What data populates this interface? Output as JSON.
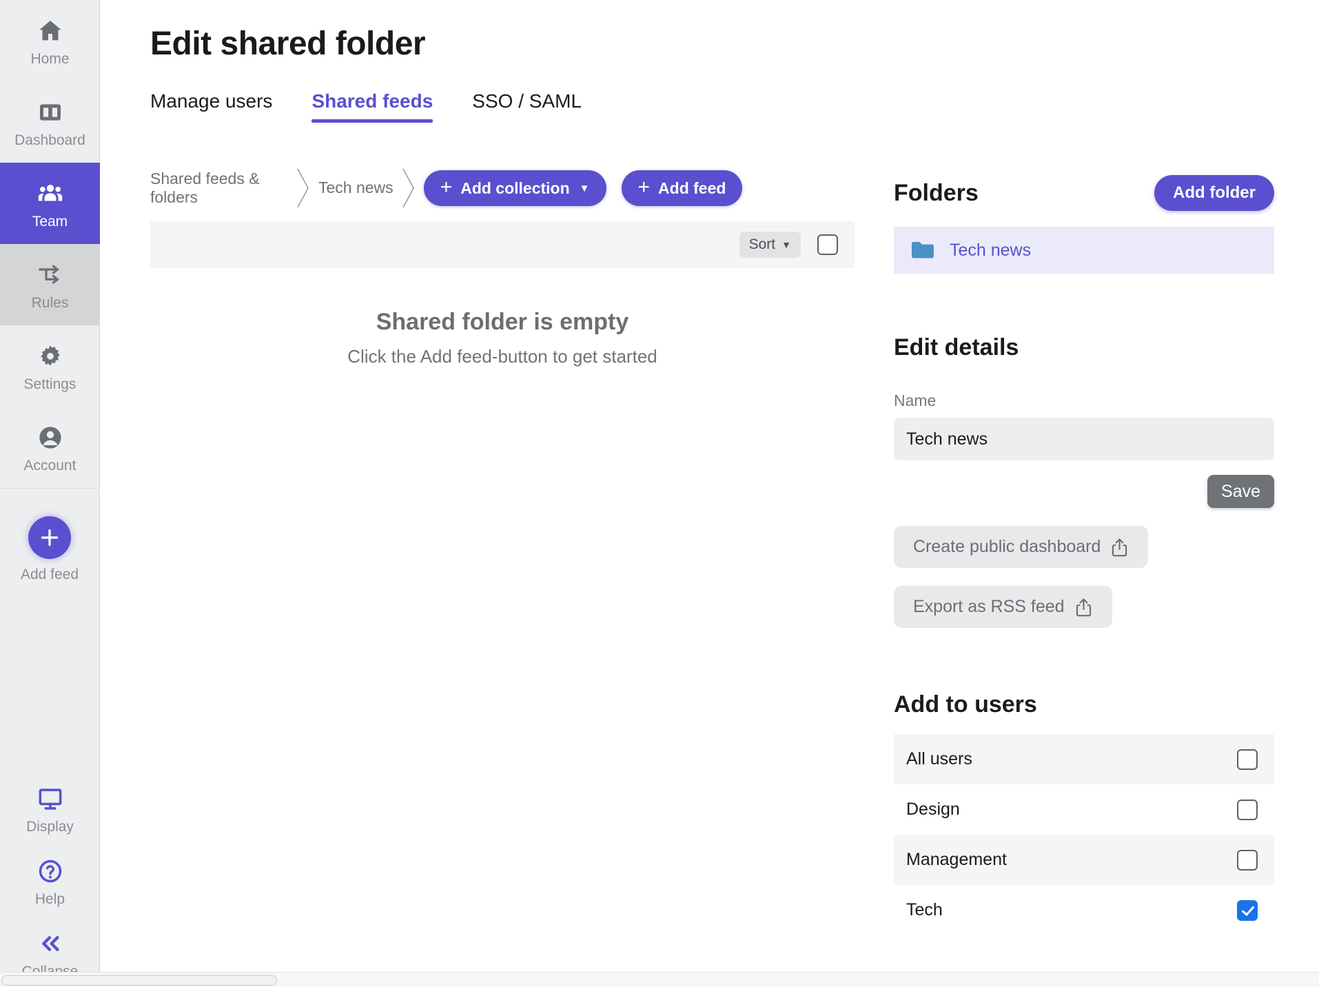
{
  "sidebar": {
    "items": [
      {
        "label": "Home",
        "icon": "home-icon",
        "state": "normal"
      },
      {
        "label": "Dashboard",
        "icon": "dashboard-icon",
        "state": "normal"
      },
      {
        "label": "Team",
        "icon": "team-icon",
        "state": "active"
      },
      {
        "label": "Rules",
        "icon": "rules-icon",
        "state": "hovered"
      },
      {
        "label": "Settings",
        "icon": "gear-icon",
        "state": "normal"
      },
      {
        "label": "Account",
        "icon": "account-icon",
        "state": "normal"
      }
    ],
    "add_feed": {
      "label": "Add feed",
      "icon": "plus-icon"
    },
    "bottom_items": [
      {
        "label": "Display",
        "icon": "display-monitor-icon"
      },
      {
        "label": "Help",
        "icon": "question-circle-icon"
      },
      {
        "label": "Collapse",
        "icon": "double-chevron-left-icon"
      }
    ]
  },
  "header": {
    "title": "Edit shared folder",
    "tabs": [
      {
        "label": "Manage users",
        "active": false
      },
      {
        "label": "Shared feeds",
        "active": true
      },
      {
        "label": "SSO / SAML",
        "active": false
      }
    ]
  },
  "breadcrumb": {
    "items": [
      "Shared feeds & folders",
      "Tech news"
    ],
    "add_collection_label": "Add collection",
    "add_feed_label": "Add feed"
  },
  "toolbar": {
    "sort_label": "Sort",
    "select_all_checked": false
  },
  "empty_state": {
    "title": "Shared folder is empty",
    "subtitle": "Click the Add feed-button to get started"
  },
  "folders_panel": {
    "title": "Folders",
    "add_folder_label": "Add folder",
    "folders": [
      {
        "name": "Tech news",
        "icon": "folder-icon",
        "selected": true
      }
    ]
  },
  "edit_details": {
    "title": "Edit details",
    "name_label": "Name",
    "name_value": "Tech news",
    "name_placeholder": "Name",
    "save_label": "Save",
    "create_public_dashboard_label": "Create public dashboard",
    "export_rss_label": "Export as RSS feed"
  },
  "add_to_users": {
    "title": "Add to users",
    "rows": [
      {
        "name": "All users",
        "checked": false
      },
      {
        "name": "Design",
        "checked": false
      },
      {
        "name": "Management",
        "checked": false
      },
      {
        "name": "Tech",
        "checked": true
      }
    ]
  },
  "colors": {
    "accent_purple": "#5a4fcf",
    "folder_blue": "#4d90c4",
    "checkbox_blue": "#1a73e8",
    "sidebar_bg": "#eceef0",
    "muted_text": "#8a8d91"
  }
}
